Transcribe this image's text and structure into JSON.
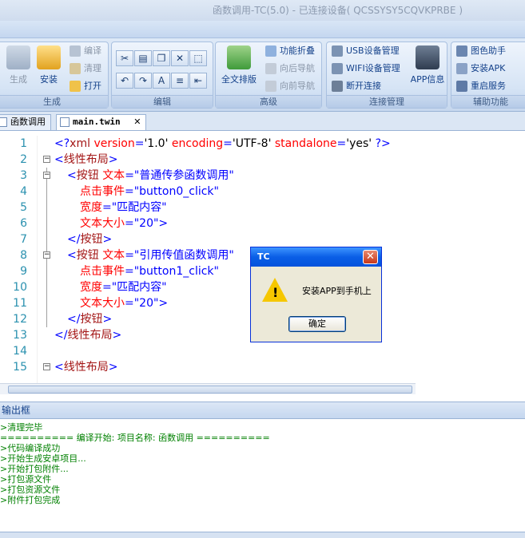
{
  "window": {
    "title": "函数调用-TC(5.0) - 已连接设备( QCSSYSY5CQVKPRBE )"
  },
  "ribbon": {
    "groups": {
      "generate": {
        "label": "生成",
        "build": "生成",
        "install": "安装",
        "compile": "编译",
        "clean": "清理",
        "open": "打开"
      },
      "edit": {
        "label": "编辑"
      },
      "advanced": {
        "label": "高级",
        "format_all": "全文排版",
        "fold": "功能折叠",
        "nav_back": "向后导航",
        "nav_forward": "向前导航"
      },
      "connection": {
        "label": "连接管理",
        "usb": "USB设备管理",
        "wifi": "WIFI设备管理",
        "disconnect": "断开连接",
        "app_info": "APP信息"
      },
      "aux": {
        "label": "辅助功能",
        "color_helper": "图色助手",
        "install_apk": "安装APK",
        "restart_service": "重启服务"
      }
    }
  },
  "doc_tabs": [
    {
      "label": "函数调用"
    },
    {
      "label": "main.twin",
      "close": "✕"
    }
  ],
  "editor": {
    "lines": [
      {
        "n": "1",
        "parts": [
          [
            "blue",
            "<?"
          ],
          [
            "maroon",
            "xml "
          ],
          [
            "red",
            "version"
          ],
          [
            "blue",
            "="
          ],
          [
            "txt",
            "'1.0' "
          ],
          [
            "red",
            "encoding"
          ],
          [
            "blue",
            "="
          ],
          [
            "txt",
            "'UTF-8' "
          ],
          [
            "red",
            "standalone"
          ],
          [
            "blue",
            "="
          ],
          [
            "txt",
            "'yes' "
          ],
          [
            "blue",
            "?>"
          ]
        ]
      },
      {
        "n": "2",
        "parts": [
          [
            "blue",
            "<"
          ],
          [
            "maroon",
            "线性布局"
          ],
          [
            "blue",
            ">"
          ]
        ]
      },
      {
        "n": "3",
        "parts": [
          [
            "blue",
            "<"
          ],
          [
            "maroon",
            "按钮 "
          ],
          [
            "red",
            "文本"
          ],
          [
            "blue",
            "=\"普通传参函数调用\""
          ]
        ]
      },
      {
        "n": "4",
        "parts": [
          [
            "red",
            "点击事件"
          ],
          [
            "blue",
            "=\"button0_click\""
          ]
        ]
      },
      {
        "n": "5",
        "parts": [
          [
            "red",
            "宽度"
          ],
          [
            "blue",
            "=\"匹配内容\""
          ]
        ]
      },
      {
        "n": "6",
        "parts": [
          [
            "red",
            "文本大小"
          ],
          [
            "blue",
            "=\"20\">"
          ]
        ]
      },
      {
        "n": "7",
        "parts": [
          [
            "blue",
            "</"
          ],
          [
            "maroon",
            "按钮"
          ],
          [
            "blue",
            ">"
          ]
        ]
      },
      {
        "n": "8",
        "parts": [
          [
            "blue",
            "<"
          ],
          [
            "maroon",
            "按钮 "
          ],
          [
            "red",
            "文本"
          ],
          [
            "blue",
            "=\"引用传值函数调用\""
          ]
        ]
      },
      {
        "n": "9",
        "parts": [
          [
            "red",
            "点击事件"
          ],
          [
            "blue",
            "=\"button1_click\""
          ]
        ]
      },
      {
        "n": "10",
        "parts": [
          [
            "red",
            "宽度"
          ],
          [
            "blue",
            "=\"匹配内容\""
          ]
        ]
      },
      {
        "n": "11",
        "parts": [
          [
            "red",
            "文本大小"
          ],
          [
            "blue",
            "=\"20\">"
          ]
        ]
      },
      {
        "n": "12",
        "parts": [
          [
            "blue",
            "</"
          ],
          [
            "maroon",
            "按钮"
          ],
          [
            "blue",
            ">"
          ]
        ]
      },
      {
        "n": "13",
        "parts": [
          [
            "blue",
            "</"
          ],
          [
            "maroon",
            "线性布局"
          ],
          [
            "blue",
            ">"
          ]
        ]
      },
      {
        "n": "14",
        "parts": []
      },
      {
        "n": "15",
        "parts": [
          [
            "blue",
            "<"
          ],
          [
            "maroon",
            "线性布局"
          ],
          [
            "blue",
            ">"
          ]
        ]
      }
    ]
  },
  "output": {
    "title": "输出框",
    "lines": [
      ">清理完毕",
      "========== 编译开始: 项目名称: 函数调用 ==========",
      ">代码编译成功",
      ">开始生成安卓项目...",
      ">开始打包附件...",
      ">打包源文件",
      ">打包资源文件",
      ">附件打包完成"
    ]
  },
  "dialog": {
    "title": "TC",
    "message": "安装APP到手机上",
    "ok": "确定",
    "close": "✕",
    "icon": "warning-icon"
  },
  "colors": {
    "accent": "#15428b",
    "code_keyword": "#0000ff",
    "code_attr": "#ff0000",
    "code_tag": "#a31515",
    "output_text": "#008000"
  }
}
